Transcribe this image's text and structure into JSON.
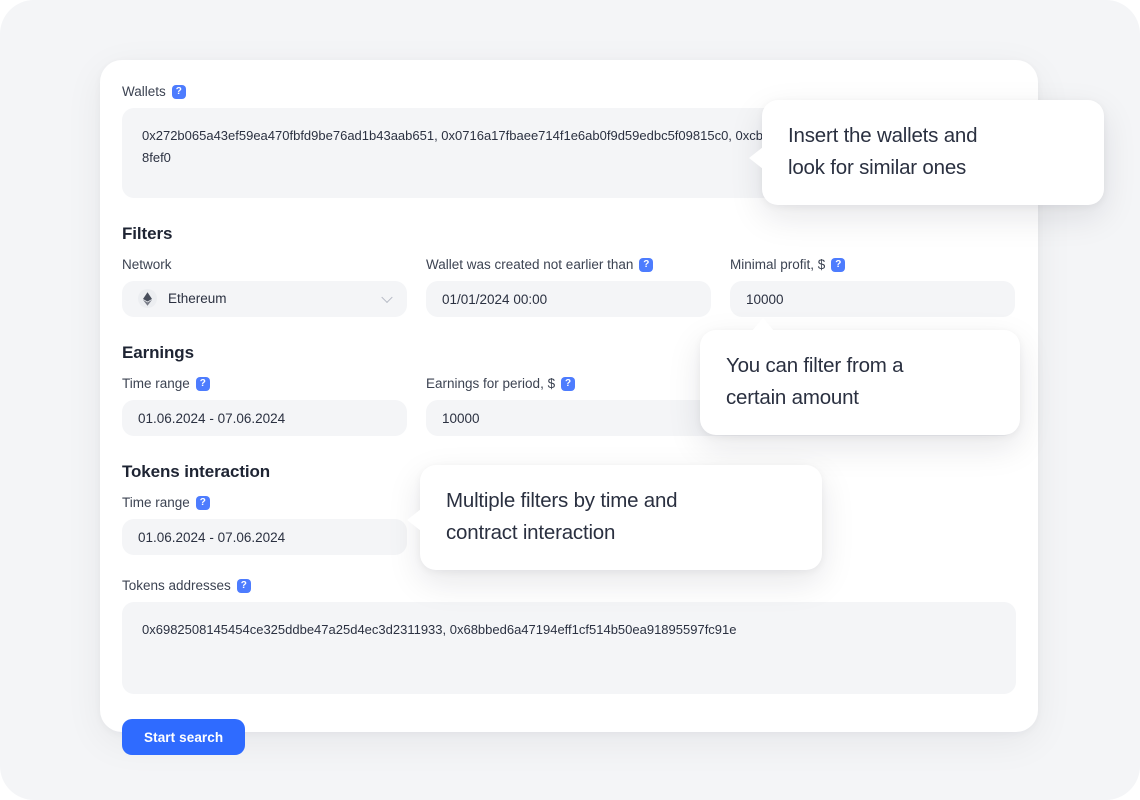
{
  "wallets": {
    "label": "Wallets",
    "help_icon": "help-question-icon",
    "value": "0x272b065a43ef59ea470fbfd9be76ad1b43aab651, 0x0716a17fbaee714f1e6ab0f9d59edbc5f09815c0, 0xcb8efb0c065071e4110932858a84365a80c8fef0"
  },
  "filters": {
    "title": "Filters",
    "network": {
      "label": "Network",
      "value": "Ethereum",
      "icon": "ethereum-icon",
      "chevron": "chevron-down-icon"
    },
    "wallet_created": {
      "label": "Wallet was created not earlier than",
      "help_icon": "help-question-icon",
      "value": "01/01/2024 00:00"
    },
    "minimal_profit": {
      "label": "Minimal profit, $",
      "help_icon": "help-question-icon",
      "value": "10000"
    }
  },
  "earnings": {
    "title": "Earnings",
    "time_range": {
      "label": "Time range",
      "help_icon": "help-question-icon",
      "value": "01.06.2024 - 07.06.2024"
    },
    "earnings_for_period": {
      "label": "Earnings for period, $",
      "help_icon": "help-question-icon",
      "value": "10000"
    }
  },
  "tokens_interaction": {
    "title": "Tokens interaction",
    "time_range": {
      "label": "Time range",
      "help_icon": "help-question-icon",
      "value": "01.06.2024 - 07.06.2024"
    },
    "tokens_addresses": {
      "label": "Tokens addresses",
      "help_icon": "help-question-icon",
      "value": "0x6982508145454ce325ddbe47a25d4ec3d2311933, 0x68bbed6a47194eff1cf514b50ea91895597fc91e"
    }
  },
  "actions": {
    "start_search": "Start search"
  },
  "callouts": [
    {
      "id": "wallets",
      "line1": "Insert the wallets and",
      "line2": "look for similar ones"
    },
    {
      "id": "profit",
      "line1": "You can filter from a",
      "line2": "certain amount"
    },
    {
      "id": "tokens",
      "line1": "Multiple filters by time and",
      "line2": "contract interaction"
    }
  ],
  "colors": {
    "accent": "#2f6bff",
    "help_badge": "#4d7cfe",
    "field_bg": "#f4f5f7",
    "page_bg": "#f4f5f7",
    "card_bg": "#ffffff",
    "text": "#2b3141"
  }
}
